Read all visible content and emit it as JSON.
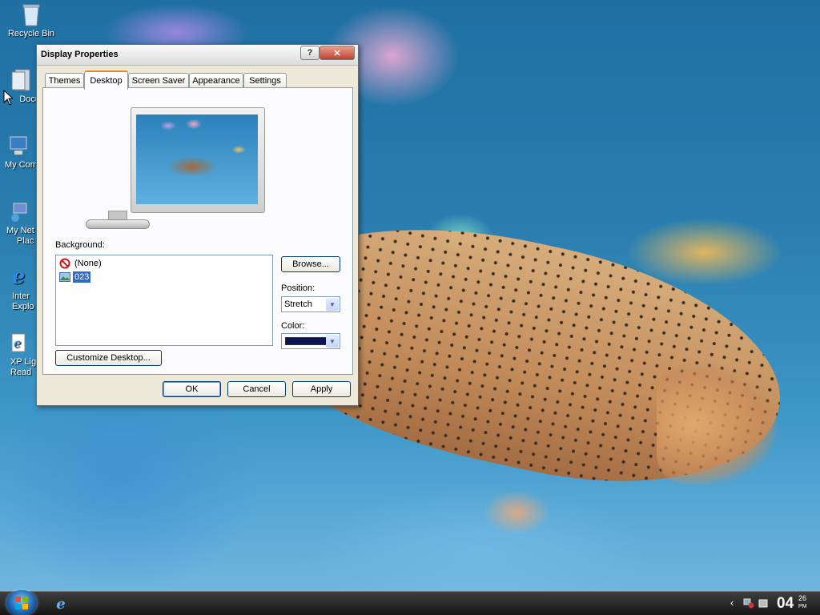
{
  "desktop": {
    "icons": [
      {
        "label": "Recycle Bin",
        "icon": "recycle-bin-icon"
      },
      {
        "label": "Docu",
        "icon": "my-documents-icon"
      },
      {
        "label": "My Com",
        "icon": "my-computer-icon"
      },
      {
        "label": "My Net",
        "label2": "Plac",
        "icon": "network-places-icon"
      },
      {
        "label": "Inter",
        "label2": "Explo",
        "icon": "internet-explorer-icon"
      },
      {
        "label": "XP Lig",
        "label2": "Read",
        "icon": "readme-icon"
      }
    ]
  },
  "dialog": {
    "title": "Display Properties",
    "help_label": "?",
    "close_label": "✕",
    "tabs": [
      {
        "label": "Themes",
        "active": false
      },
      {
        "label": "Desktop",
        "active": true
      },
      {
        "label": "Screen Saver",
        "active": false
      },
      {
        "label": "Appearance",
        "active": false
      },
      {
        "label": "Settings",
        "active": false
      }
    ],
    "background_label": "Background:",
    "background_items": [
      {
        "label": "(None)",
        "icon": "no-symbol-icon",
        "selected": false
      },
      {
        "label": "023",
        "icon": "image-file-icon",
        "selected": true
      }
    ],
    "browse_label": "Browse...",
    "position_label": "Position:",
    "position_value": "Stretch",
    "color_label": "Color:",
    "color_value": "#0a1450",
    "customize_label": "Customize Desktop...",
    "ok_label": "OK",
    "cancel_label": "Cancel",
    "apply_label": "Apply"
  },
  "taskbar": {
    "start_icon": "windows-logo-icon",
    "quicklaunch_icon": "internet-explorer-icon",
    "tray_expand": "‹",
    "clock_hour": "04",
    "clock_min": "26",
    "clock_ampm": "PM"
  }
}
